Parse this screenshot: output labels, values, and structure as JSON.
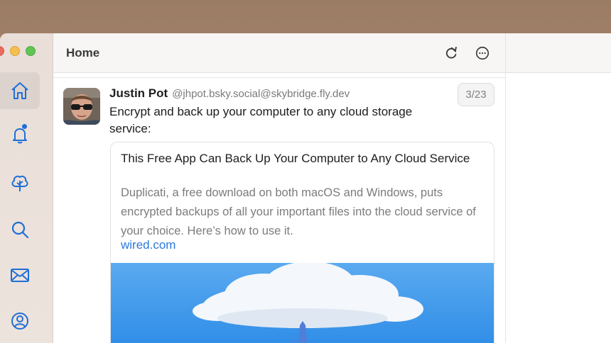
{
  "window": {
    "title": "Home"
  },
  "sidebar": {
    "items": [
      {
        "name": "home",
        "icon": "home-icon",
        "active": true
      },
      {
        "name": "notifications",
        "icon": "bell-icon",
        "has_badge": true
      },
      {
        "name": "feeds",
        "icon": "tree-icon"
      },
      {
        "name": "search",
        "icon": "search-icon"
      },
      {
        "name": "messages",
        "icon": "envelope-icon"
      },
      {
        "name": "profile",
        "icon": "user-circle-icon"
      }
    ]
  },
  "header": {
    "title": "Home",
    "refresh_icon": "refresh-icon",
    "more_icon": "ellipsis-circle-icon"
  },
  "post": {
    "author_name": "Justin Pot",
    "author_handle": "@jhpot.bsky.social@skybridge.fly.dev",
    "counter": "3/23",
    "text": "Encrypt and back up your computer to any cloud storage service:",
    "link_card": {
      "title": "This Free App Can Back Up Your Computer to Any Cloud Service",
      "description": "Duplicati, a free download on both macOS and Windows, puts encrypted backups of all your important files into the cloud service of your choice. Here’s how to use it.",
      "domain": "wired.com"
    }
  },
  "colors": {
    "accent": "#1f6fd6",
    "link": "#2a79dc",
    "sidebar_bg": "#ebe1db"
  }
}
